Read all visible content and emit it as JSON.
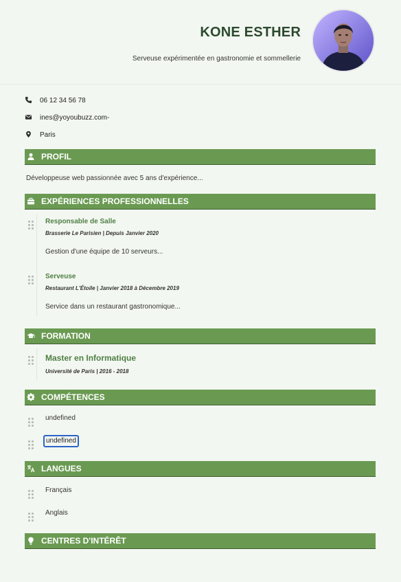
{
  "header": {
    "name": "KONE ESTHER",
    "tagline": "Serveuse expérimentée en gastronomie et sommellerie"
  },
  "contact": {
    "phone": "06 12 34 56 78",
    "email": "ines@yoyoubuzz.com-",
    "location": "Paris"
  },
  "sections": {
    "profile": {
      "title": "PROFIL",
      "text": "Développeuse web passionnée avec 5 ans d'expérience..."
    },
    "experience": {
      "title": "EXPÉRIENCES PROFESSIONNELLES",
      "items": [
        {
          "role": "Responsable de Salle",
          "meta": "Brasserie Le Parisien  |  Depuis Janvier 2020",
          "desc": "Gestion d'une équipe de 10 serveurs..."
        },
        {
          "role": "Serveuse",
          "meta": "Restaurant L'Étoile  |  Janvier 2018 à Décembre 2019",
          "desc": "Service dans un restaurant gastronomique..."
        }
      ]
    },
    "education": {
      "title": "FORMATION",
      "items": [
        {
          "degree": "Master en Informatique",
          "meta": "Université de Paris  |  2016 - 2018"
        }
      ]
    },
    "skills": {
      "title": "COMPÉTENCES",
      "items": [
        "undefined",
        "undefined"
      ]
    },
    "languages": {
      "title": "LANGUES",
      "items": [
        "Français",
        "Anglais"
      ]
    },
    "interests": {
      "title": "CENTRES D'INTÉRÊT"
    }
  },
  "colors": {
    "accent": "#6a9a52",
    "accent_dark": "#3f5c31",
    "title_green": "#4f7f45",
    "name_color": "#2c4a2e",
    "background": "#f3f7f1",
    "focus_blue": "#2a64c9"
  },
  "icons": {
    "phone": "phone-icon",
    "email": "envelope-icon",
    "location": "map-pin-icon",
    "profile": "user-icon",
    "experience": "briefcase-icon",
    "education": "graduation-cap-icon",
    "skills": "gear-icon",
    "languages": "translate-icon",
    "interests": "lightbulb-icon",
    "drag": "drag-handle-icon"
  }
}
